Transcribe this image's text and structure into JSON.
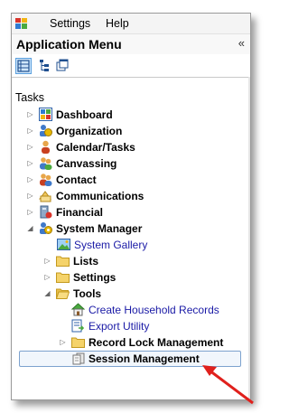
{
  "menubar": {
    "items": [
      "Settings",
      "Help"
    ]
  },
  "panel": {
    "title": "Application Menu",
    "collapse_glyph": "«"
  },
  "section": {
    "label": "Tasks"
  },
  "tree": {
    "dashboard": "Dashboard",
    "organization": "Organization",
    "calendar": "Calendar/Tasks",
    "canvassing": "Canvassing",
    "contact": "Contact",
    "communications": "Communications",
    "financial": "Financial",
    "system_manager": "System Manager",
    "system_gallery": "System Gallery",
    "lists": "Lists",
    "settings": "Settings",
    "tools": "Tools",
    "create_household": "Create Household Records",
    "export_utility": "Export Utility",
    "record_lock": "Record Lock Management",
    "session_management": "Session Management"
  },
  "glyphs": {
    "collapsed": "▷",
    "expanded": "◢"
  },
  "colors": {
    "selection_border": "#7da2ce",
    "link": "#1a1aa6",
    "arrow": "#e0201c"
  }
}
